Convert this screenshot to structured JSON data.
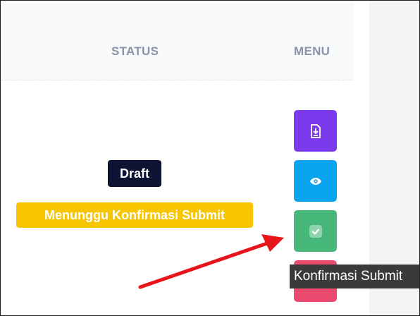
{
  "table": {
    "headers": {
      "status": "STATUS",
      "menu": "MENU"
    },
    "row": {
      "status_badges": [
        {
          "label": "Draft",
          "color": "#0d1333"
        },
        {
          "label": "Menunggu Konfirmasi Submit",
          "color": "#f7c600"
        }
      ],
      "menu_buttons": [
        {
          "icon": "file-download-icon",
          "color": "#7c3aed"
        },
        {
          "icon": "eye-icon",
          "color": "#0aa3f0"
        },
        {
          "icon": "check-icon",
          "color": "#46b87a"
        },
        {
          "icon": "trash-icon",
          "color": "#e94a6e"
        }
      ]
    }
  },
  "tooltip": {
    "text": "Konfirmasi Submit"
  },
  "annotation": {
    "type": "red-arrow",
    "color": "#e8141b"
  }
}
